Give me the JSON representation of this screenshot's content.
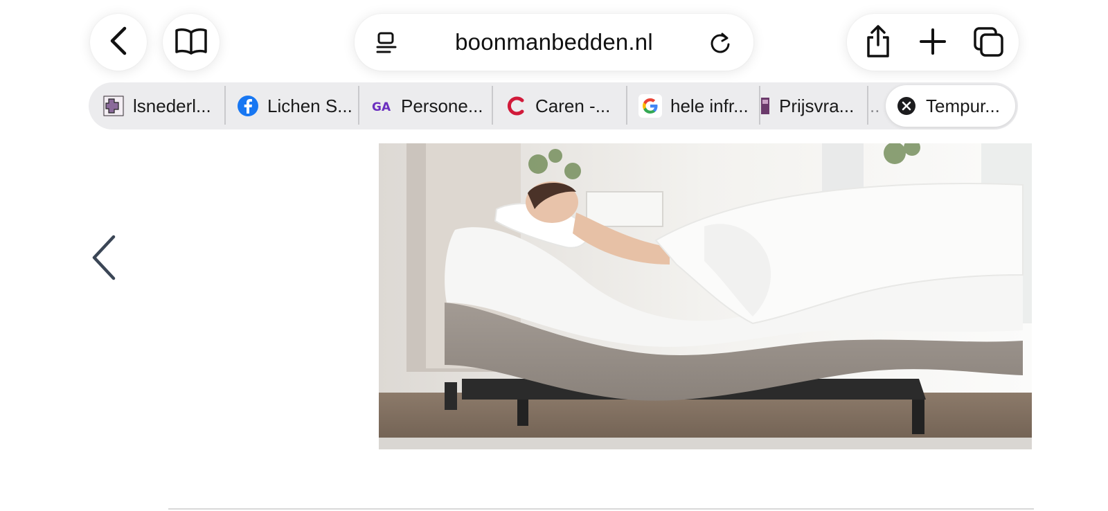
{
  "toolbar": {
    "url": "boonmanbedden.nl",
    "back_icon": "chevron-left-icon",
    "reader_icon": "open-book-icon",
    "page_menu_icon": "page-menu-icon",
    "reload_icon": "reload-icon",
    "share_icon": "share-icon",
    "new_tab_icon": "plus-icon",
    "tabs_icon": "tabs-overview-icon"
  },
  "tabs": [
    {
      "title": "lsnederl...",
      "favicon": "puzzle-favicon"
    },
    {
      "title": "Lichen S...",
      "favicon": "facebook-favicon",
      "color": "#1877F2"
    },
    {
      "title": "Persone...",
      "favicon": "ga-favicon",
      "color": "#6b2fbf"
    },
    {
      "title": "Caren -...",
      "favicon": "c-favicon",
      "color": "#d11a3a"
    },
    {
      "title": "hele infr...",
      "favicon": "google-favicon"
    },
    {
      "title": "Prijsvra...",
      "favicon": "purple-favicon",
      "color": "#6b3a6b"
    },
    {
      "title": "..",
      "favicon": ""
    }
  ],
  "active_tab": {
    "title": "Tempur...",
    "close_icon": "close-icon"
  },
  "content": {
    "prev_icon": "chevron-left-icon",
    "hero_alt": "adjustable-bed-image"
  },
  "colors": {
    "accent_text": "#111111",
    "arrow": "#3b4656",
    "tabstrip_bg": "#ececee"
  }
}
